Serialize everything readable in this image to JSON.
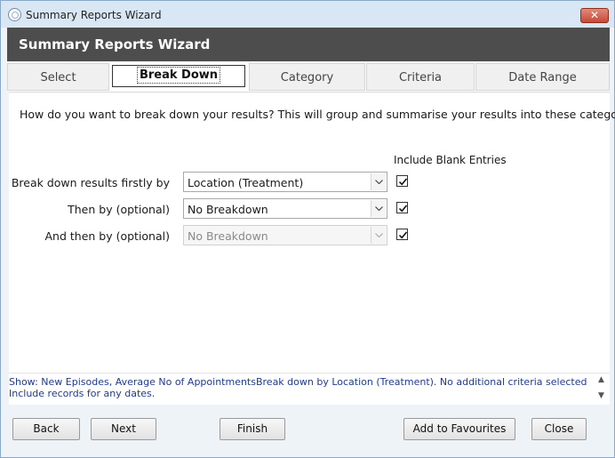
{
  "window": {
    "title": "Summary Reports Wizard",
    "close_glyph": "✕"
  },
  "header": {
    "title": "Summary Reports Wizard"
  },
  "tabs": [
    {
      "label": "Select"
    },
    {
      "label": "Break Down",
      "active": true
    },
    {
      "label": "Category"
    },
    {
      "label": "Criteria"
    },
    {
      "label": "Date Range"
    }
  ],
  "content": {
    "question": "How do you want to break down your results? This will group and summarise your results into these categories",
    "include_blank_header": "Include Blank Entries",
    "rows": [
      {
        "label": "Break down results firstly by",
        "value": "Location (Treatment)",
        "enabled": true,
        "include_blank": true
      },
      {
        "label": "Then by (optional)",
        "value": "No Breakdown",
        "enabled": true,
        "include_blank": true
      },
      {
        "label": "And then by (optional)",
        "value": "No Breakdown",
        "enabled": false,
        "include_blank": true
      }
    ]
  },
  "summary": {
    "text": "Show: New Episodes, Average No of AppointmentsBreak down by Location (Treatment). No additional criteria selected Include records for any dates."
  },
  "footer": {
    "back": "Back",
    "next": "Next",
    "finish": "Finish",
    "add_to_favourites": "Add to Favourites",
    "close": "Close"
  }
}
